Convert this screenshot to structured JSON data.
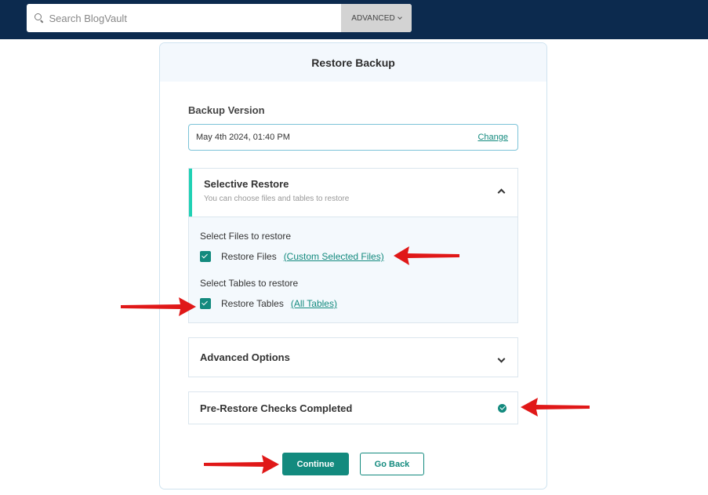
{
  "topbar": {
    "search_placeholder": "Search BlogVault",
    "advanced_label": "ADVANCED"
  },
  "dialog": {
    "title": "Restore Backup",
    "backup_version": {
      "label": "Backup Version",
      "value": "May 4th 2024, 01:40 PM",
      "change_label": "Change"
    },
    "selective_restore": {
      "title": "Selective Restore",
      "subtitle": "You can choose files and tables to restore",
      "files_label": "Select Files to restore",
      "files_checkbox_label": "Restore Files",
      "files_checked": true,
      "files_link": "(Custom Selected Files)",
      "tables_label": "Select Tables to restore",
      "tables_checkbox_label": "Restore Tables",
      "tables_checked": true,
      "tables_link": "(All Tables)"
    },
    "advanced_options": {
      "title": "Advanced Options"
    },
    "pre_restore": {
      "title": "Pre-Restore Checks Completed",
      "status": "completed"
    },
    "buttons": {
      "continue": "Continue",
      "go_back": "Go Back"
    }
  },
  "colors": {
    "topbar": "#0c2a4e",
    "accent": "#138a7e",
    "highlight_border": "#1fd1b4",
    "annotation_arrow": "#e01818"
  }
}
